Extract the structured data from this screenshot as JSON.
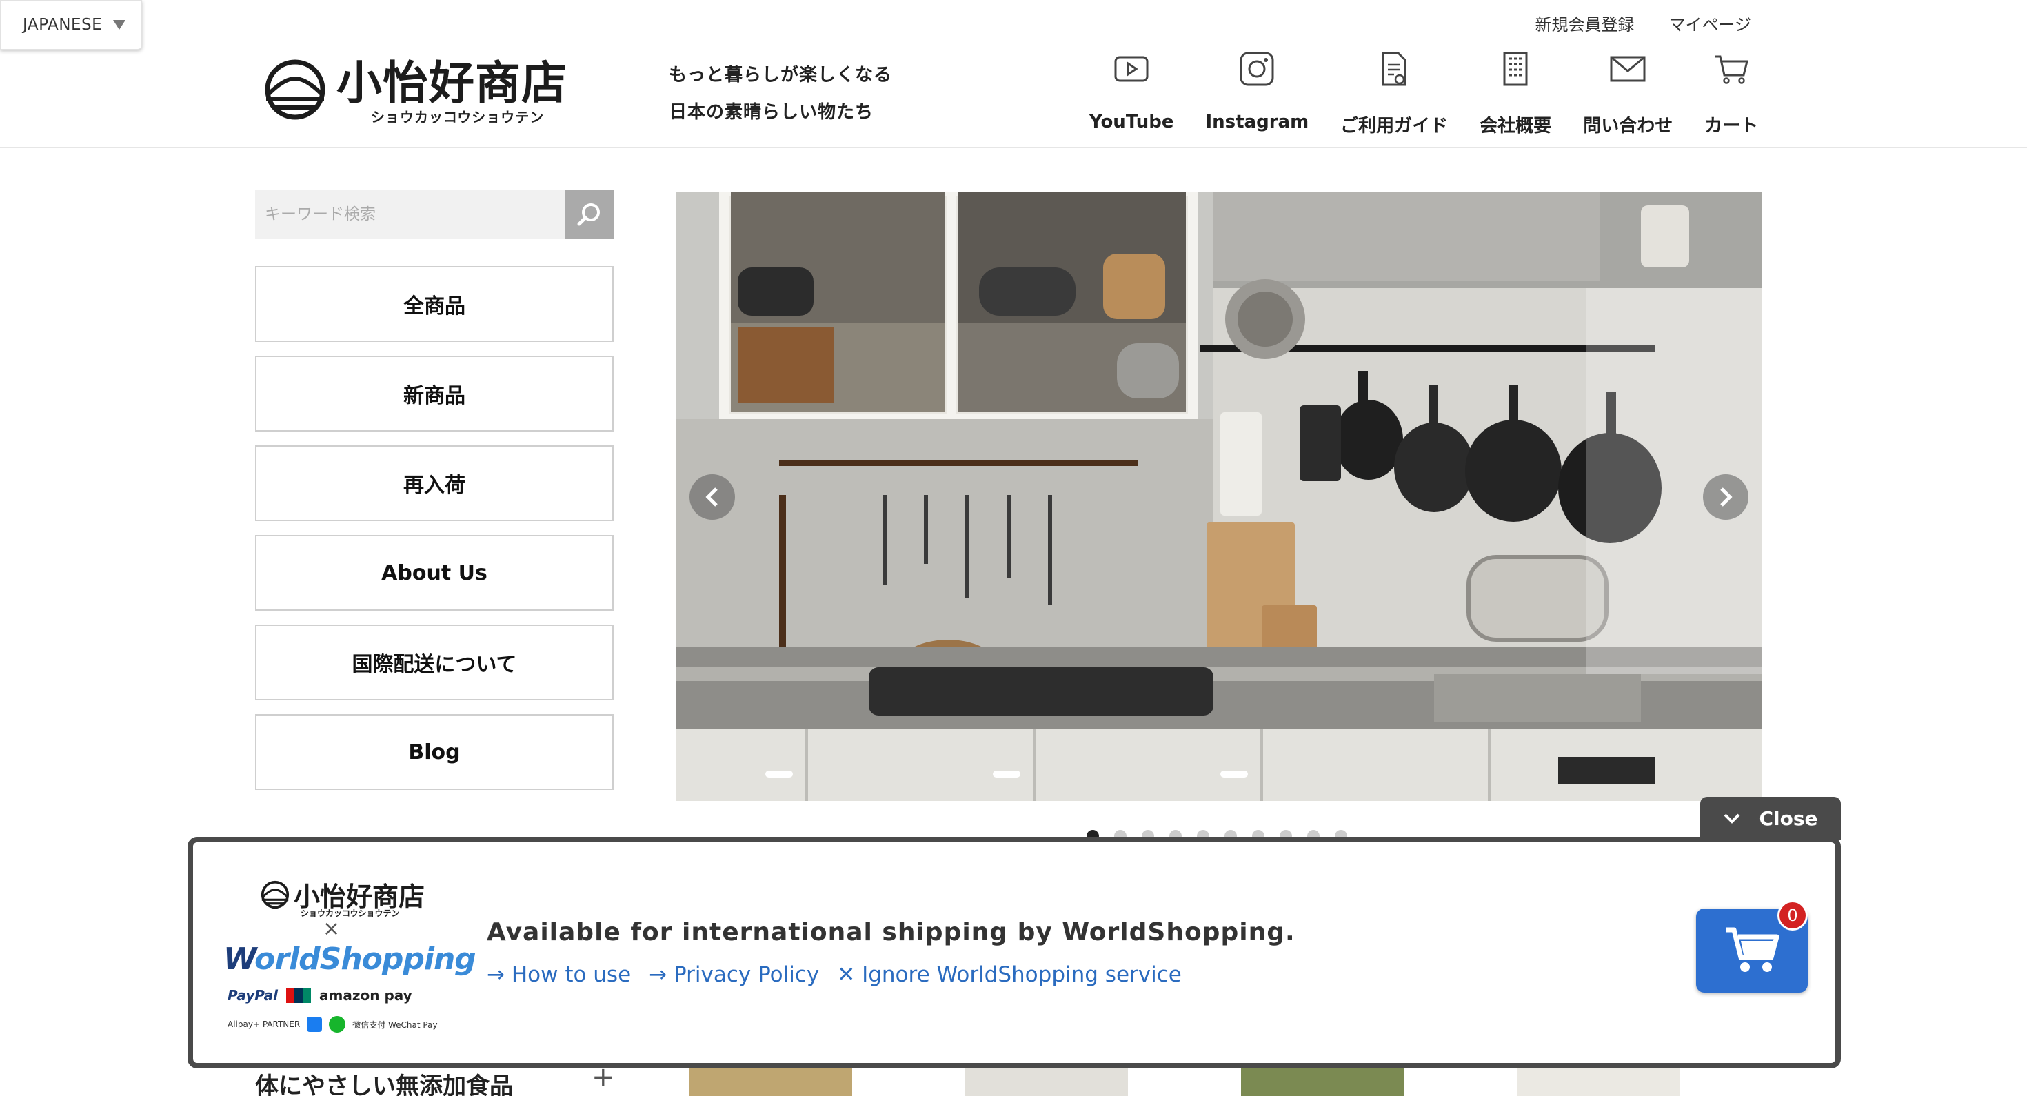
{
  "language_selector": {
    "label": "JAPANESE"
  },
  "header": {
    "logo_title": "小怡好商店",
    "logo_kana": "ショウカッコウショウテン",
    "tagline": [
      "もっと暮らしが楽しくなる",
      "日本の素晴らしい物たち"
    ],
    "top_links": {
      "register": "新規会員登録",
      "mypage": "マイページ"
    },
    "nav": [
      {
        "label": "YouTube",
        "icon": "youtube-icon"
      },
      {
        "label": "Instagram",
        "icon": "instagram-icon"
      },
      {
        "label": "ご利用ガイド",
        "icon": "guide-icon"
      },
      {
        "label": "会社概要",
        "icon": "building-icon"
      },
      {
        "label": "問い合わせ",
        "icon": "mail-icon"
      },
      {
        "label": "カート",
        "icon": "cart-icon"
      }
    ]
  },
  "search": {
    "placeholder": "キーワード検索"
  },
  "sidebar": {
    "menu": [
      "全商品",
      "新商品",
      "再入荷",
      "About Us",
      "国際配送について",
      "Blog"
    ],
    "category_heading": "体にやさしい無添加食品",
    "category_toggle": "+"
  },
  "carousel": {
    "slide_count": 10,
    "active_index": 0
  },
  "worldshopping": {
    "close_label": "Close",
    "shop_logo": "小怡好商店",
    "shop_kana": "ショウカッコウショウテン",
    "times": "×",
    "brand_w": "W",
    "brand_rest": "orldShopping",
    "payments": [
      "PayPal",
      "amazon pay"
    ],
    "payments_small": [
      "Alipay+ PARTNER",
      "微信支付 WeChat Pay"
    ],
    "title": "Available for international shipping by WorldShopping.",
    "links": [
      "→ How to use",
      "→ Privacy Policy",
      "✕ Ignore WorldShopping service"
    ],
    "cart_count": "0"
  },
  "colors": {
    "accent_blue": "#2d6fd0",
    "link_blue": "#2a6bbf",
    "badge_red": "#d32222",
    "overlay_border": "#4a4a4a"
  }
}
